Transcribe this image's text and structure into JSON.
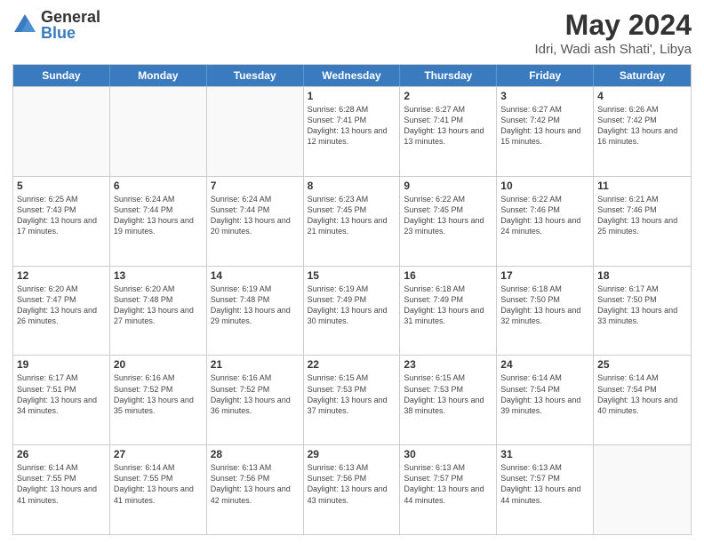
{
  "logo": {
    "general": "General",
    "blue": "Blue"
  },
  "title": {
    "month_year": "May 2024",
    "location": "Idri, Wadi ash Shati', Libya"
  },
  "days_of_week": [
    "Sunday",
    "Monday",
    "Tuesday",
    "Wednesday",
    "Thursday",
    "Friday",
    "Saturday"
  ],
  "weeks": [
    [
      {
        "day": "",
        "empty": true
      },
      {
        "day": "",
        "empty": true
      },
      {
        "day": "",
        "empty": true
      },
      {
        "day": "1",
        "sunrise": "6:28 AM",
        "sunset": "7:41 PM",
        "daylight": "13 hours and 12 minutes."
      },
      {
        "day": "2",
        "sunrise": "6:27 AM",
        "sunset": "7:41 PM",
        "daylight": "13 hours and 13 minutes."
      },
      {
        "day": "3",
        "sunrise": "6:27 AM",
        "sunset": "7:42 PM",
        "daylight": "13 hours and 15 minutes."
      },
      {
        "day": "4",
        "sunrise": "6:26 AM",
        "sunset": "7:42 PM",
        "daylight": "13 hours and 16 minutes."
      }
    ],
    [
      {
        "day": "5",
        "sunrise": "6:25 AM",
        "sunset": "7:43 PM",
        "daylight": "13 hours and 17 minutes."
      },
      {
        "day": "6",
        "sunrise": "6:24 AM",
        "sunset": "7:44 PM",
        "daylight": "13 hours and 19 minutes."
      },
      {
        "day": "7",
        "sunrise": "6:24 AM",
        "sunset": "7:44 PM",
        "daylight": "13 hours and 20 minutes."
      },
      {
        "day": "8",
        "sunrise": "6:23 AM",
        "sunset": "7:45 PM",
        "daylight": "13 hours and 21 minutes."
      },
      {
        "day": "9",
        "sunrise": "6:22 AM",
        "sunset": "7:45 PM",
        "daylight": "13 hours and 23 minutes."
      },
      {
        "day": "10",
        "sunrise": "6:22 AM",
        "sunset": "7:46 PM",
        "daylight": "13 hours and 24 minutes."
      },
      {
        "day": "11",
        "sunrise": "6:21 AM",
        "sunset": "7:46 PM",
        "daylight": "13 hours and 25 minutes."
      }
    ],
    [
      {
        "day": "12",
        "sunrise": "6:20 AM",
        "sunset": "7:47 PM",
        "daylight": "13 hours and 26 minutes."
      },
      {
        "day": "13",
        "sunrise": "6:20 AM",
        "sunset": "7:48 PM",
        "daylight": "13 hours and 27 minutes."
      },
      {
        "day": "14",
        "sunrise": "6:19 AM",
        "sunset": "7:48 PM",
        "daylight": "13 hours and 29 minutes."
      },
      {
        "day": "15",
        "sunrise": "6:19 AM",
        "sunset": "7:49 PM",
        "daylight": "13 hours and 30 minutes."
      },
      {
        "day": "16",
        "sunrise": "6:18 AM",
        "sunset": "7:49 PM",
        "daylight": "13 hours and 31 minutes."
      },
      {
        "day": "17",
        "sunrise": "6:18 AM",
        "sunset": "7:50 PM",
        "daylight": "13 hours and 32 minutes."
      },
      {
        "day": "18",
        "sunrise": "6:17 AM",
        "sunset": "7:50 PM",
        "daylight": "13 hours and 33 minutes."
      }
    ],
    [
      {
        "day": "19",
        "sunrise": "6:17 AM",
        "sunset": "7:51 PM",
        "daylight": "13 hours and 34 minutes."
      },
      {
        "day": "20",
        "sunrise": "6:16 AM",
        "sunset": "7:52 PM",
        "daylight": "13 hours and 35 minutes."
      },
      {
        "day": "21",
        "sunrise": "6:16 AM",
        "sunset": "7:52 PM",
        "daylight": "13 hours and 36 minutes."
      },
      {
        "day": "22",
        "sunrise": "6:15 AM",
        "sunset": "7:53 PM",
        "daylight": "13 hours and 37 minutes."
      },
      {
        "day": "23",
        "sunrise": "6:15 AM",
        "sunset": "7:53 PM",
        "daylight": "13 hours and 38 minutes."
      },
      {
        "day": "24",
        "sunrise": "6:14 AM",
        "sunset": "7:54 PM",
        "daylight": "13 hours and 39 minutes."
      },
      {
        "day": "25",
        "sunrise": "6:14 AM",
        "sunset": "7:54 PM",
        "daylight": "13 hours and 40 minutes."
      }
    ],
    [
      {
        "day": "26",
        "sunrise": "6:14 AM",
        "sunset": "7:55 PM",
        "daylight": "13 hours and 41 minutes."
      },
      {
        "day": "27",
        "sunrise": "6:14 AM",
        "sunset": "7:55 PM",
        "daylight": "13 hours and 41 minutes."
      },
      {
        "day": "28",
        "sunrise": "6:13 AM",
        "sunset": "7:56 PM",
        "daylight": "13 hours and 42 minutes."
      },
      {
        "day": "29",
        "sunrise": "6:13 AM",
        "sunset": "7:56 PM",
        "daylight": "13 hours and 43 minutes."
      },
      {
        "day": "30",
        "sunrise": "6:13 AM",
        "sunset": "7:57 PM",
        "daylight": "13 hours and 44 minutes."
      },
      {
        "day": "31",
        "sunrise": "6:13 AM",
        "sunset": "7:57 PM",
        "daylight": "13 hours and 44 minutes."
      },
      {
        "day": "",
        "empty": true
      }
    ]
  ]
}
